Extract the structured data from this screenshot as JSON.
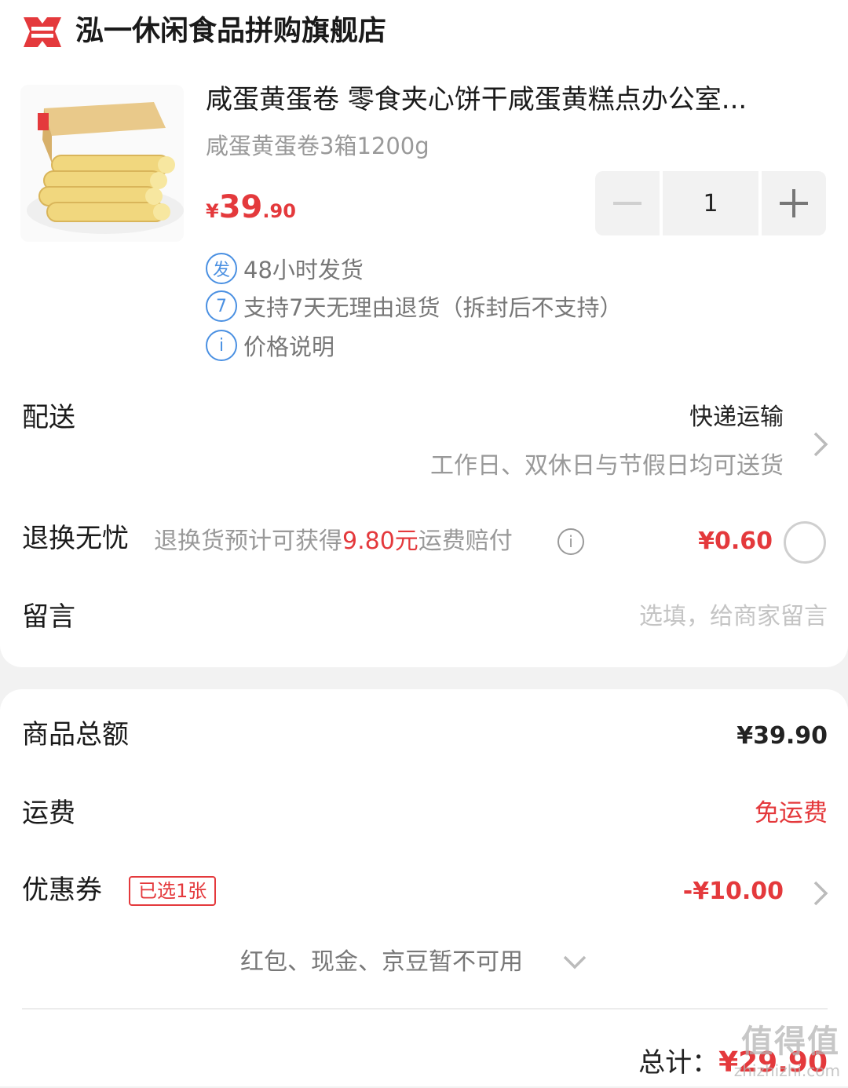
{
  "shop": {
    "name": "泓一休闲食品拼购旗舰店",
    "logo_icon": "shop-logo-icon"
  },
  "product": {
    "title": "咸蛋黄蛋卷 零食夹心饼干咸蛋黄糕点办公室...",
    "spec": "咸蛋黄蛋卷3箱1200g",
    "price_symbol": "¥",
    "price_int": "39",
    "price_dec": ".90",
    "quantity": "1"
  },
  "services": [
    {
      "icon_char": "发",
      "text": "48小时发货"
    },
    {
      "icon_char": "7",
      "text": "支持7天无理由退货（拆封后不支持）"
    },
    {
      "icon_char": "i",
      "text": "价格说明"
    }
  ],
  "delivery": {
    "label": "配送",
    "method": "快递运输",
    "note": "工作日、双休日与节假日均可送货"
  },
  "return_worry": {
    "label": "退换无忧",
    "desc_prefix": "退换货预计可获得",
    "desc_amount": "9.80元",
    "desc_suffix": "运费赔付",
    "price": "¥0.60"
  },
  "message": {
    "label": "留言",
    "placeholder": "选填，给商家留言"
  },
  "summary": {
    "goods_total_label": "商品总额",
    "goods_total_value": "¥39.90",
    "shipping_label": "运费",
    "shipping_value": "免运费",
    "coupon_label": "优惠券",
    "coupon_badge": "已选1张",
    "coupon_value": "-¥10.00",
    "unavailable_text": "红包、现金、京豆暂不可用",
    "total_label": "总计：",
    "total_value": "¥29.90"
  },
  "watermark": {
    "big": "值得值",
    "small": "zhizhizhi.com"
  },
  "colors": {
    "accent": "#e4393c",
    "service_blue": "#4a90e2"
  }
}
